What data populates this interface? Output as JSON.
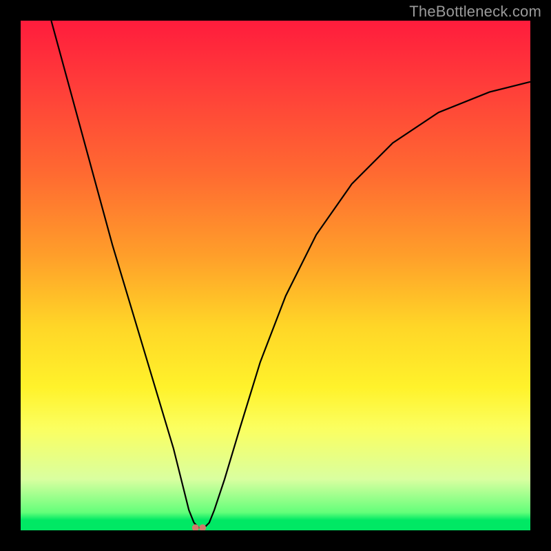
{
  "watermark": {
    "text": "TheBottleneck.com"
  },
  "chart_data": {
    "type": "line",
    "title": "",
    "xlabel": "",
    "ylabel": "",
    "xlim": [
      0,
      100
    ],
    "ylim": [
      0,
      100
    ],
    "grid": false,
    "legend": false,
    "note": "Values read from pixel positions; chart has no numeric tick labels.",
    "series": [
      {
        "name": "bottleneck-curve",
        "x": [
          6,
          9,
          12,
          15,
          18,
          21,
          24,
          27,
          30,
          32,
          33,
          34,
          35,
          36,
          37,
          38,
          40,
          43,
          47,
          52,
          58,
          65,
          73,
          82,
          92,
          100
        ],
        "values": [
          100,
          89,
          78,
          67,
          56,
          46,
          36,
          26,
          16,
          8,
          4,
          1.5,
          0.5,
          0.5,
          1.5,
          4,
          10,
          20,
          33,
          46,
          58,
          68,
          76,
          82,
          86,
          88
        ]
      }
    ],
    "markers": [
      {
        "name": "dip-marker-left",
        "x": 34.3,
        "y": 0.5,
        "color": "#d07a6a"
      },
      {
        "name": "dip-marker-right",
        "x": 35.7,
        "y": 0.5,
        "color": "#d07a6a"
      }
    ],
    "background_gradient": {
      "direction": "vertical",
      "stops": [
        {
          "pos": 0.0,
          "color": "#ff1c3c"
        },
        {
          "pos": 0.46,
          "color": "#ff9e2a"
        },
        {
          "pos": 0.72,
          "color": "#fff22b"
        },
        {
          "pos": 0.9,
          "color": "#d9ffa0"
        },
        {
          "pos": 0.98,
          "color": "#00e864"
        },
        {
          "pos": 1.0,
          "color": "#00e864"
        }
      ]
    }
  }
}
